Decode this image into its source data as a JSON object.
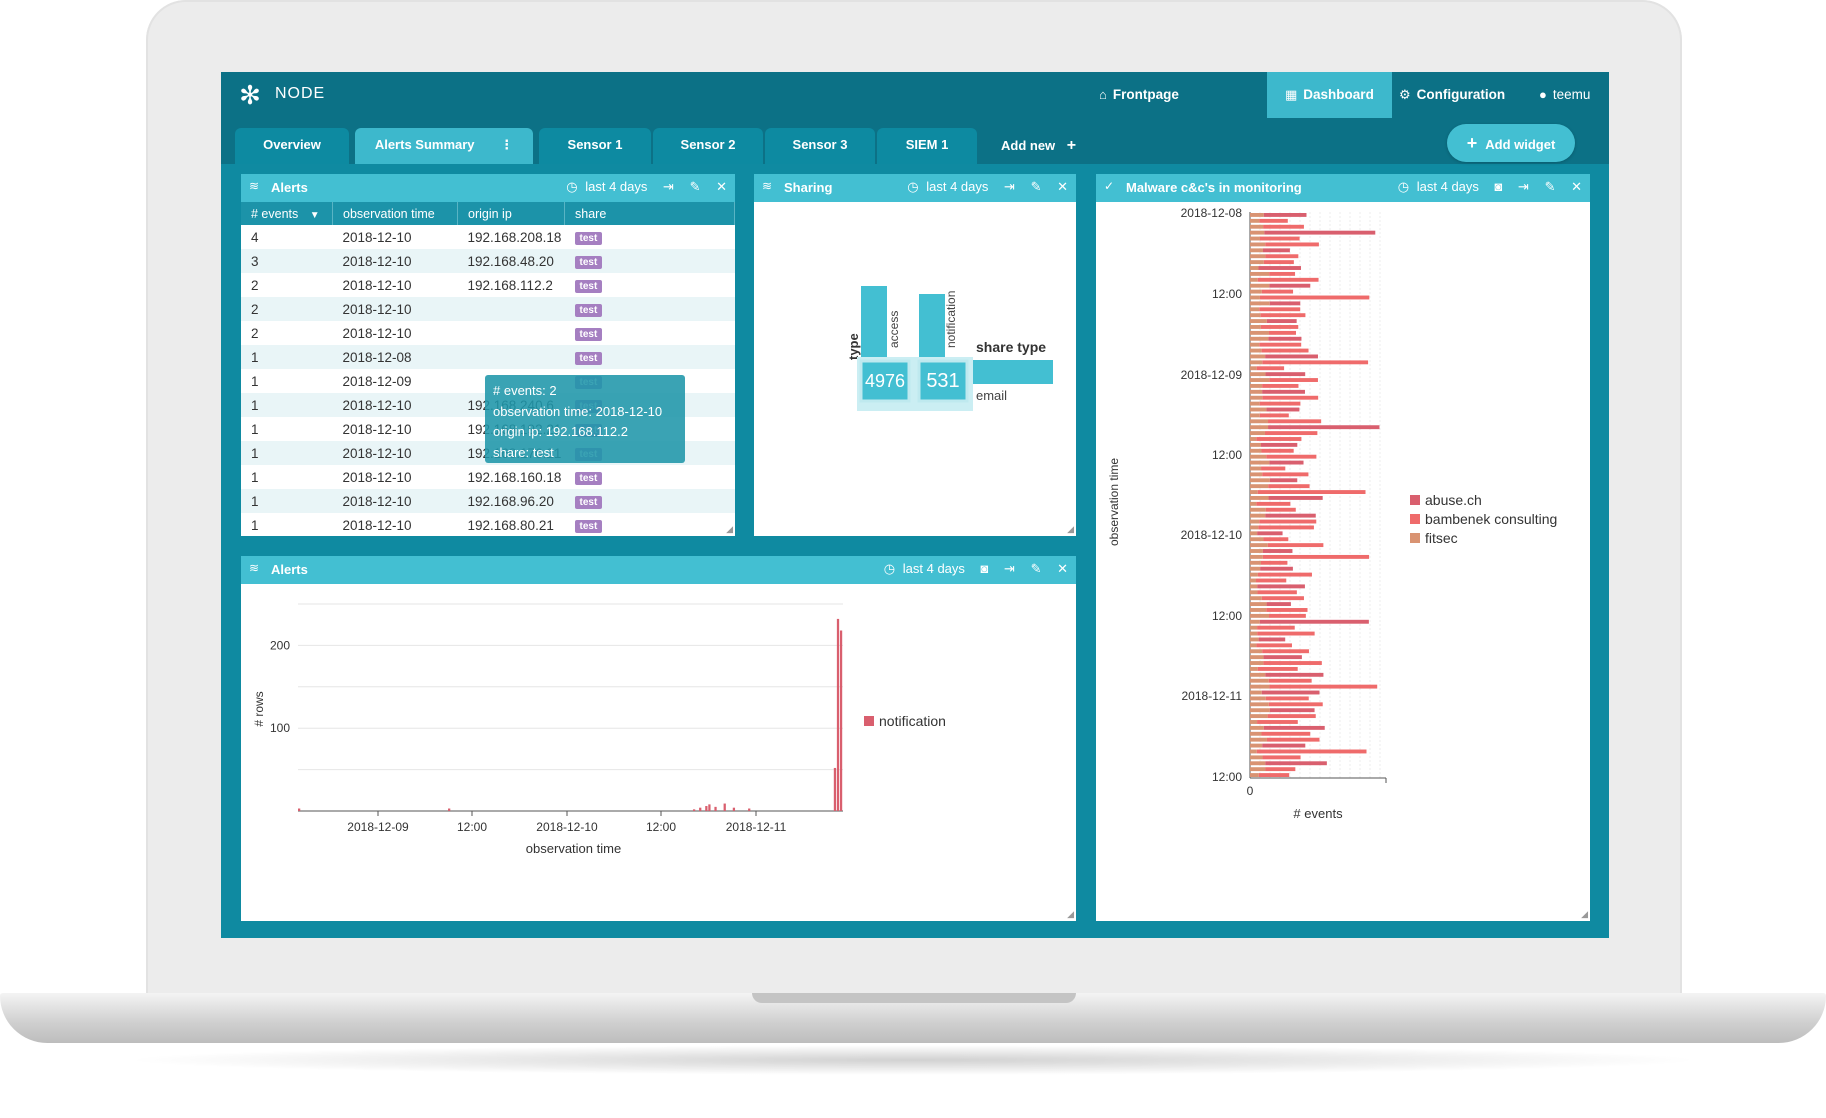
{
  "app": {
    "brand": "NODE"
  },
  "nav": {
    "frontpage": "Frontpage",
    "dashboard": "Dashboard",
    "configuration": "Configuration",
    "user": "teemu"
  },
  "tabs": [
    "Overview",
    "Alerts Summary",
    "Sensor 1",
    "Sensor 2",
    "Sensor 3",
    "SIEM 1"
  ],
  "tabs_extra": {
    "add_new": "Add new",
    "add_widget": "Add widget"
  },
  "widgets": {
    "alerts_table": {
      "title": "Alerts",
      "range": "last 4 days",
      "columns": [
        "# events",
        "observation time",
        "origin ip",
        "share"
      ],
      "rows": [
        [
          "4",
          "2018-12-10",
          "192.168.208.18",
          "test"
        ],
        [
          "3",
          "2018-12-10",
          "192.168.48.20",
          "test"
        ],
        [
          "2",
          "2018-12-10",
          "192.168.112.2",
          "test"
        ],
        [
          "2",
          "2018-12-10",
          "",
          "test"
        ],
        [
          "2",
          "2018-12-10",
          "",
          "test"
        ],
        [
          "1",
          "2018-12-08",
          "",
          "test"
        ],
        [
          "1",
          "2018-12-09",
          "",
          "test"
        ],
        [
          "1",
          "2018-12-10",
          "192.168.240.6",
          "test"
        ],
        [
          "1",
          "2018-12-10",
          "192.168.192.21",
          "test"
        ],
        [
          "1",
          "2018-12-10",
          "192.168.176.21",
          "test"
        ],
        [
          "1",
          "2018-12-10",
          "192.168.160.18",
          "test"
        ],
        [
          "1",
          "2018-12-10",
          "192.168.96.20",
          "test"
        ],
        [
          "1",
          "2018-12-10",
          "192.168.80.21",
          "test"
        ]
      ],
      "tooltip": [
        "# events: 2",
        "observation time: 2018-12-10",
        "origin ip: 192.168.112.2",
        "share: test"
      ]
    },
    "sharing": {
      "title": "Sharing",
      "range": "last 4 days",
      "type_label": "type",
      "share_type_label": "share type",
      "types": [
        "access",
        "notification"
      ],
      "values": [
        "4976",
        "531"
      ],
      "share_types": [
        "email"
      ]
    },
    "malware": {
      "title": "Malware c&c's in monitoring",
      "range": "last 4 days"
    },
    "alerts_chart": {
      "title": "Alerts",
      "range": "last 4 days"
    }
  },
  "colors": {
    "accent": "#43bfd2",
    "topbar": "#0c7186",
    "screen": "#0f8aa1",
    "abuse": "#d95f6e",
    "bambenek": "#ef6b6b",
    "fitsec": "#d99372"
  },
  "chart_data": [
    {
      "type": "bar",
      "title": "",
      "xlabel": "observation time",
      "ylabel": "# rows",
      "x_ticks": [
        "2018-12-09",
        "12:00",
        "2018-12-10",
        "12:00",
        "2018-12-11"
      ],
      "y_ticks": [
        100,
        200
      ],
      "ylim": [
        0,
        250
      ],
      "series": [
        {
          "name": "notification",
          "values": [
            3,
            0,
            0,
            0,
            0,
            0,
            0,
            0,
            0,
            0,
            0,
            0,
            0,
            0,
            0,
            0,
            0,
            0,
            0,
            0,
            0,
            0,
            0,
            0,
            0,
            0,
            0,
            0,
            0,
            0,
            0,
            0,
            0,
            0,
            0,
            0,
            0,
            0,
            0,
            0,
            0,
            0,
            0,
            0,
            0,
            0,
            0,
            0,
            0,
            3,
            0,
            0,
            0,
            0,
            0,
            0,
            0,
            0,
            0,
            0,
            0,
            0,
            0,
            0,
            0,
            0,
            0,
            0,
            0,
            0,
            0,
            0,
            0,
            0,
            0,
            0,
            0,
            0,
            0,
            0,
            0,
            0,
            0,
            0,
            0,
            0,
            0,
            0,
            0,
            0,
            0,
            0,
            0,
            0,
            0,
            0,
            0,
            0,
            0,
            0,
            0,
            0,
            0,
            0,
            0,
            0,
            0,
            0,
            0,
            0,
            0,
            0,
            0,
            0,
            0,
            0,
            0,
            0,
            0,
            0,
            0,
            0,
            0,
            0,
            0,
            0,
            0,
            0,
            0,
            2,
            0,
            4,
            0,
            6,
            8,
            0,
            5,
            0,
            0,
            9,
            0,
            0,
            4,
            0,
            0,
            0,
            0,
            3,
            0,
            0,
            0,
            0,
            0,
            0,
            0,
            0,
            0,
            0,
            0,
            0,
            0,
            0,
            0,
            0,
            0,
            0,
            0,
            0,
            0,
            0,
            0,
            0,
            0,
            0,
            0,
            52,
            232,
            218
          ]
        }
      ],
      "legend": "right",
      "grid": true
    },
    {
      "type": "bar",
      "orientation": "horizontal",
      "stacked": true,
      "ylabel": "observation time",
      "xlabel": "# events",
      "y_ticks": [
        "2018-12-08",
        "12:00",
        "2018-12-09",
        "12:00",
        "2018-12-10",
        "12:00",
        "2018-12-11",
        "12:00"
      ],
      "x_ticks": [
        0
      ],
      "series": [
        {
          "name": "abuse.ch"
        },
        {
          "name": "bambenek consulting"
        },
        {
          "name": "fitsec"
        }
      ],
      "legend": "right",
      "grid": true
    }
  ]
}
